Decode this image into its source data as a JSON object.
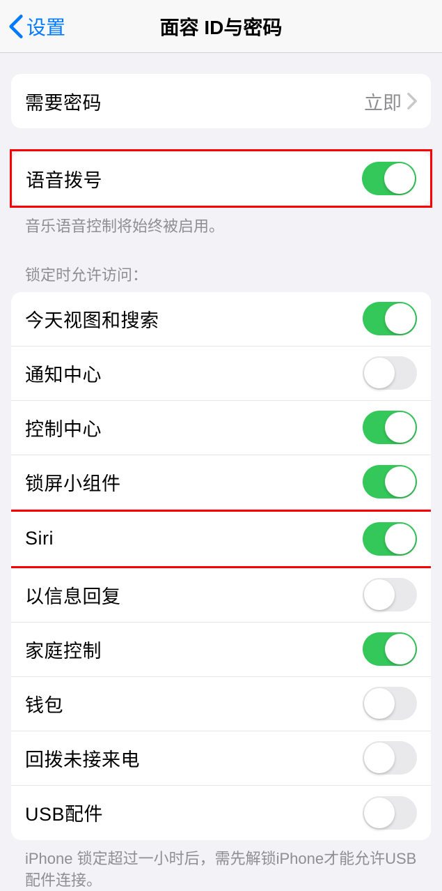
{
  "nav": {
    "back_label": "设置",
    "title": "面容 ID与密码"
  },
  "require_passcode": {
    "label": "需要密码",
    "value": "立即"
  },
  "voice_dial": {
    "label": "语音拨号",
    "on": true,
    "footer": "音乐语音控制将始终被启用。"
  },
  "allow_access": {
    "header": "锁定时允许访问：",
    "items": [
      {
        "label": "今天视图和搜索",
        "on": true
      },
      {
        "label": "通知中心",
        "on": false
      },
      {
        "label": "控制中心",
        "on": true
      },
      {
        "label": "锁屏小组件",
        "on": true
      },
      {
        "label": "Siri",
        "on": true
      },
      {
        "label": "以信息回复",
        "on": false
      },
      {
        "label": "家庭控制",
        "on": true
      },
      {
        "label": "钱包",
        "on": false
      },
      {
        "label": "回拨未接来电",
        "on": false
      },
      {
        "label": "USB配件",
        "on": false
      }
    ],
    "footer": "iPhone 锁定超过一小时后，需先解锁iPhone才能允许USB 配件连接。"
  }
}
